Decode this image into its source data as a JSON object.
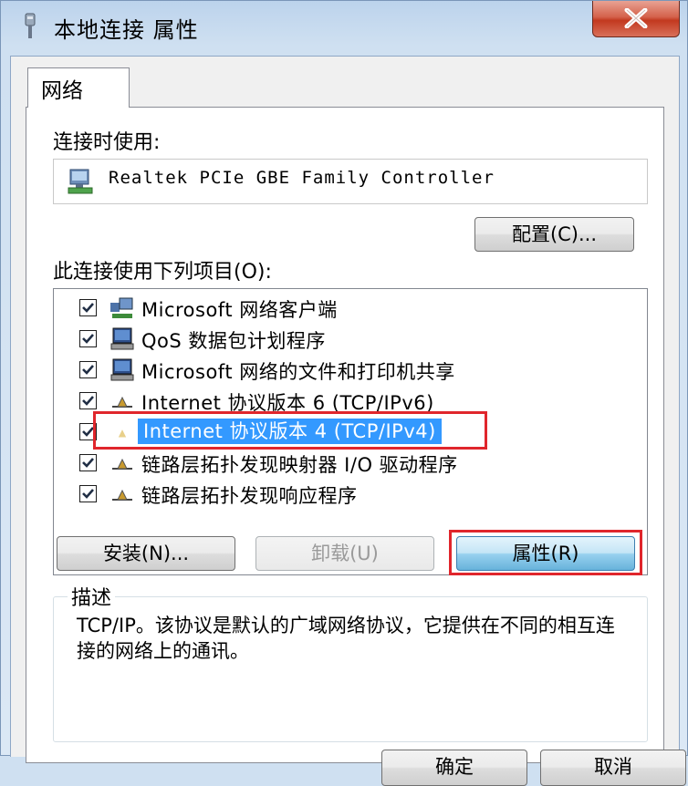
{
  "window": {
    "title": "本地连接 属性"
  },
  "tabs": [
    {
      "label": "网络"
    }
  ],
  "connect_using": {
    "label": "连接时使用:",
    "adapter_name": "Realtek PCIe GBE Family Controller",
    "configure_button": "配置(C)..."
  },
  "items_section": {
    "label": "此连接使用下列项目(O):",
    "items": [
      {
        "label": "Microsoft 网络客户端",
        "checked": true,
        "icon": "network-client-icon"
      },
      {
        "label": "QoS 数据包计划程序",
        "checked": true,
        "icon": "computer-service-icon"
      },
      {
        "label": "Microsoft 网络的文件和打印机共享",
        "checked": true,
        "icon": "computer-service-icon"
      },
      {
        "label": "Internet 协议版本 6 (TCP/IPv6)",
        "checked": true,
        "icon": "protocol-icon"
      },
      {
        "label": "Internet 协议版本 4 (TCP/IPv4)",
        "checked": true,
        "icon": "protocol-icon",
        "selected": true
      },
      {
        "label": "链路层拓扑发现映射器 I/O 驱动程序",
        "checked": true,
        "icon": "protocol-icon"
      },
      {
        "label": "链路层拓扑发现响应程序",
        "checked": true,
        "icon": "protocol-icon"
      }
    ]
  },
  "buttons": {
    "install": "安装(N)...",
    "uninstall": "卸载(U)",
    "properties": "属性(R)"
  },
  "description": {
    "legend": "描述",
    "text": "TCP/IP。该协议是默认的广域网络协议，它提供在不同的相互连接的网络上的通讯。"
  },
  "footer": {
    "ok": "确定",
    "cancel": "取消"
  },
  "colors": {
    "selection": "#3399ff",
    "highlight_box": "#e0262c"
  }
}
